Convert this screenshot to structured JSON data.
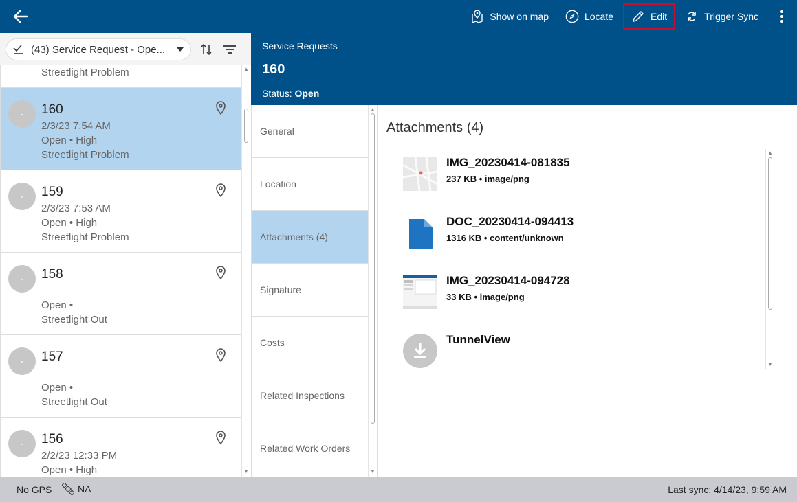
{
  "toolbar": {
    "show_on_map": "Show on map",
    "locate": "Locate",
    "edit": "Edit",
    "trigger_sync": "Trigger Sync"
  },
  "filter": {
    "label": "(43) Service Request - Ope..."
  },
  "list": {
    "partial_item": "Streetlight Problem",
    "items": [
      {
        "avatar": "-",
        "num": "160",
        "date": "2/3/23 7:54 AM",
        "status": "Open • High",
        "type": "Streetlight Problem",
        "selected": true
      },
      {
        "avatar": "-",
        "num": "159",
        "date": "2/3/23 7:53 AM",
        "status": "Open • High",
        "type": "Streetlight Problem",
        "selected": false
      },
      {
        "avatar": "-",
        "num": "158",
        "date": "",
        "status": "Open •",
        "type": "Streetlight Out",
        "selected": false
      },
      {
        "avatar": "-",
        "num": "157",
        "date": "",
        "status": "Open •",
        "type": "Streetlight Out",
        "selected": false
      },
      {
        "avatar": "-",
        "num": "156",
        "date": "2/2/23 12:33 PM",
        "status": "Open • High",
        "type": "",
        "selected": false
      }
    ]
  },
  "detail": {
    "category": "Service Requests",
    "id": "160",
    "status_label": "Status:",
    "status_value": "Open"
  },
  "sections": [
    {
      "label": "General"
    },
    {
      "label": "Location"
    },
    {
      "label": "Attachments (4)"
    },
    {
      "label": "Signature"
    },
    {
      "label": "Costs"
    },
    {
      "label": "Related Inspections"
    },
    {
      "label": "Related Work Orders"
    }
  ],
  "active_section": "Attachments (4)",
  "attachments": {
    "title": "Attachments (4)",
    "items": [
      {
        "name": "IMG_20230414-081835",
        "meta": "237 KB • image/png",
        "icon": "map-thumbnail"
      },
      {
        "name": "DOC_20230414-094413",
        "meta": "1316 KB • content/unknown",
        "icon": "document-icon"
      },
      {
        "name": "IMG_20230414-094728",
        "meta": "33 KB • image/png",
        "icon": "screenshot-thumbnail"
      },
      {
        "name": "TunnelView",
        "meta": "",
        "icon": "download-icon"
      }
    ]
  },
  "statusbar": {
    "gps": "No GPS",
    "na": "NA",
    "last_sync": "Last sync: 4/14/23, 9:59 AM"
  },
  "colors": {
    "header": "#00508a",
    "selection": "#b3d4ef",
    "edit_highlight": "#c8102e",
    "doc_blue": "#1f74c2"
  }
}
